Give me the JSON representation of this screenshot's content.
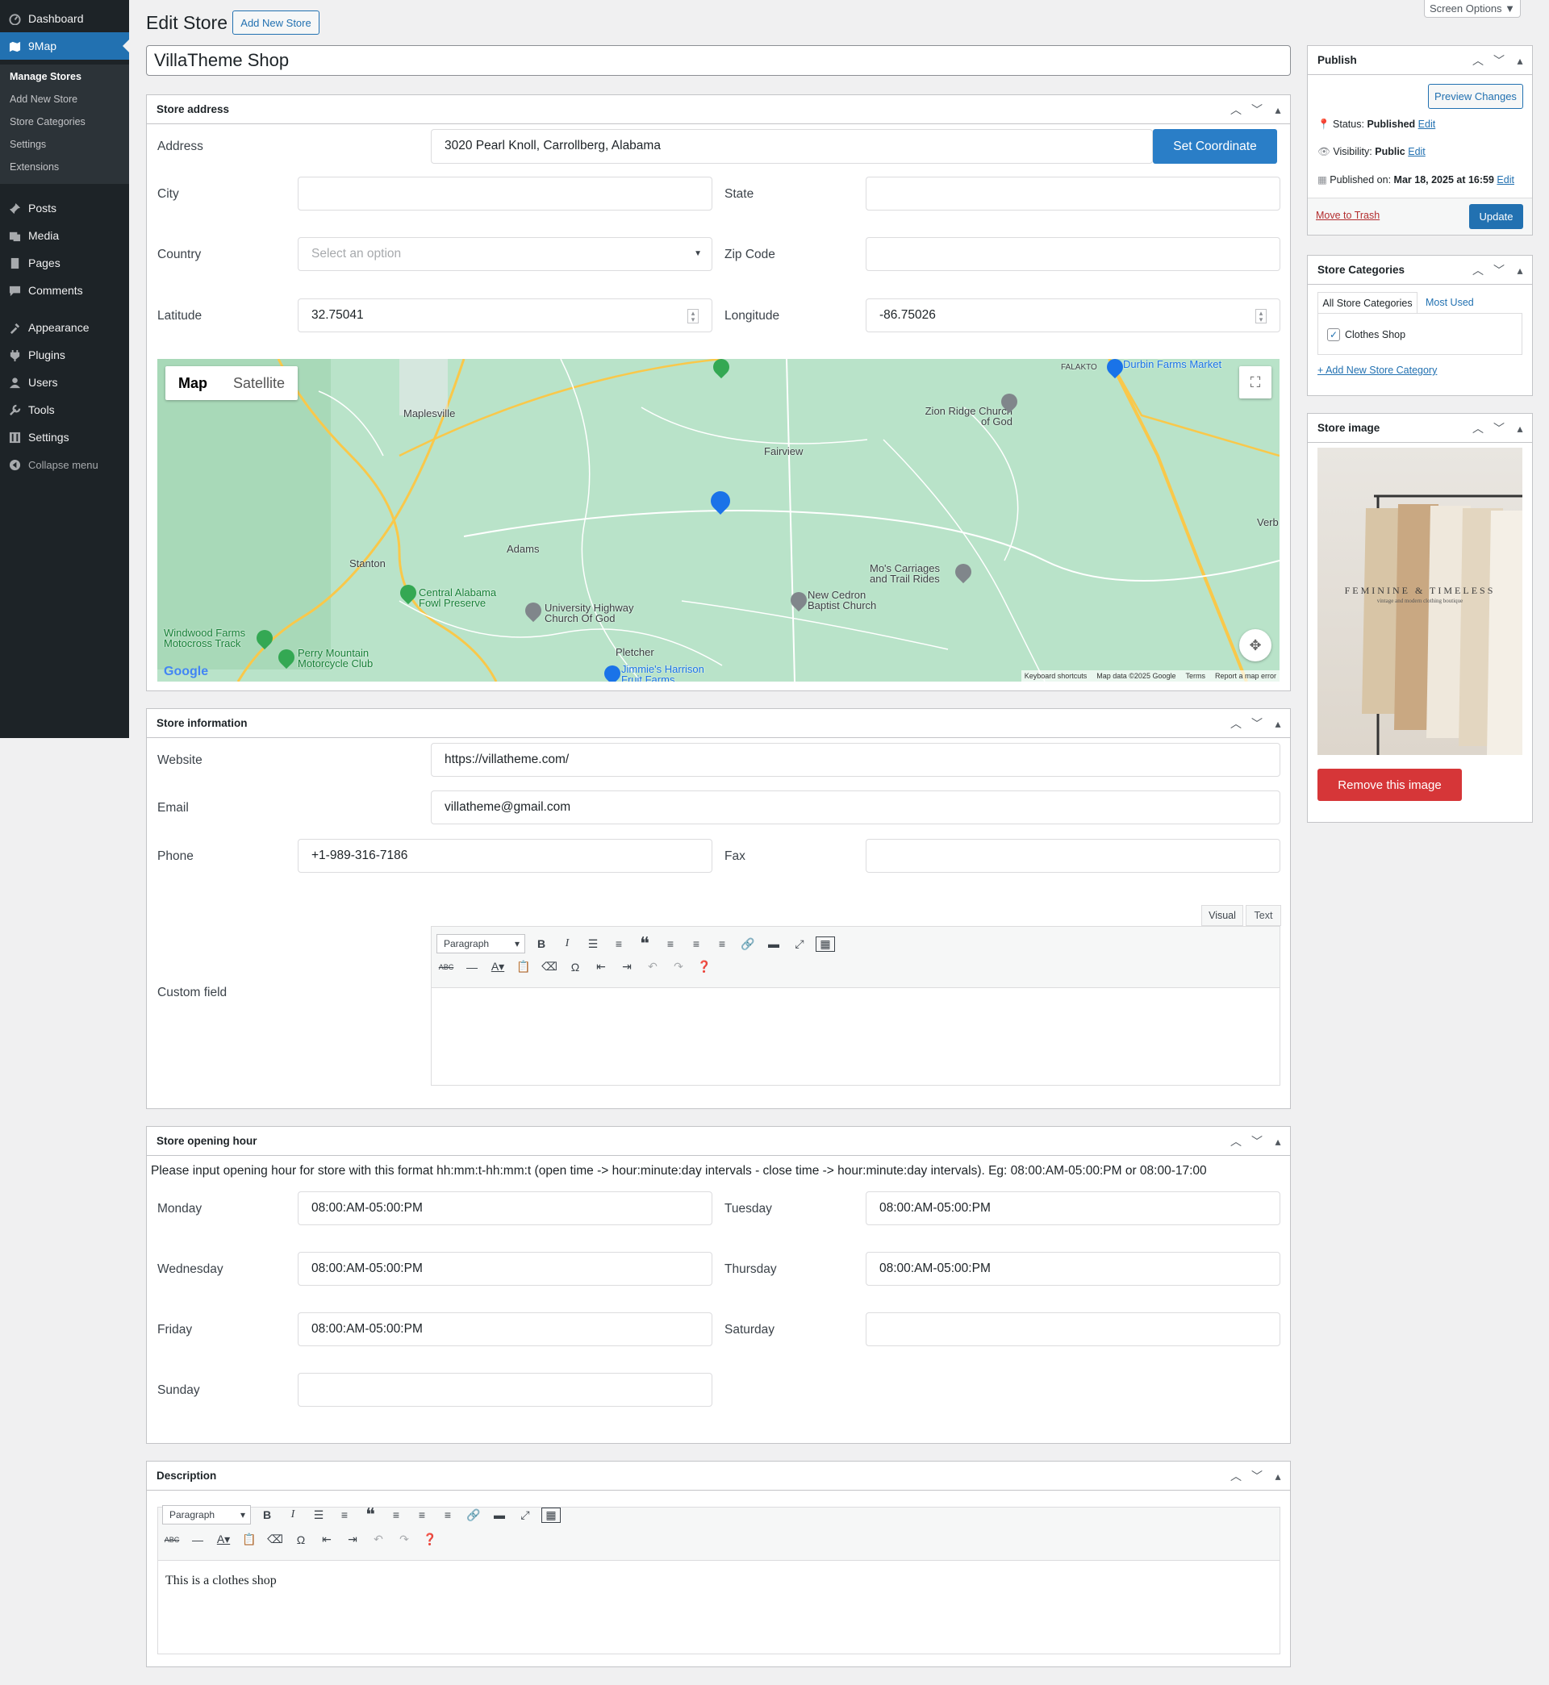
{
  "sidebar": {
    "items": [
      {
        "label": "Dashboard",
        "icon": "dashboard-icon"
      },
      {
        "label": "9Map",
        "icon": "map-icon"
      },
      {
        "label": "Posts",
        "icon": "pin-icon"
      },
      {
        "label": "Media",
        "icon": "media-icon"
      },
      {
        "label": "Pages",
        "icon": "pages-icon"
      },
      {
        "label": "Comments",
        "icon": "comments-icon"
      },
      {
        "label": "Appearance",
        "icon": "appearance-icon"
      },
      {
        "label": "Plugins",
        "icon": "plugins-icon"
      },
      {
        "label": "Users",
        "icon": "users-icon"
      },
      {
        "label": "Tools",
        "icon": "tools-icon"
      },
      {
        "label": "Settings",
        "icon": "settings-icon"
      },
      {
        "label": "Collapse menu",
        "icon": "collapse-icon"
      }
    ],
    "submenu": [
      "Manage Stores",
      "Add New Store",
      "Store Categories",
      "Settings",
      "Extensions"
    ]
  },
  "header": {
    "title": "Edit Store",
    "add_new": "Add New Store",
    "screen_options": "Screen Options ▼"
  },
  "post_title": "VillaTheme Shop",
  "store_address": {
    "heading": "Store address",
    "address_label": "Address",
    "address_value": "3020 Pearl Knoll, Carrollberg, Alabama",
    "set_coordinate": "Set Coordinate",
    "city_label": "City",
    "city_value": "",
    "state_label": "State",
    "state_value": "",
    "country_label": "Country",
    "country_placeholder": "Select an option",
    "zip_label": "Zip Code",
    "zip_value": "",
    "latitude_label": "Latitude",
    "latitude_value": "32.75041",
    "longitude_label": "Longitude",
    "longitude_value": "-86.75026"
  },
  "map": {
    "map_btn": "Map",
    "satellite_btn": "Satellite",
    "labels": [
      "Maplesville",
      "Fairview",
      "Adams",
      "Stanton",
      "Pletcher",
      "Verb"
    ],
    "pois_green": [
      "Central Alabama Fowl Preserve",
      "Windwood Farms Motocross Track",
      "Perry Mountain Motorcycle Club"
    ],
    "pois_gray": [
      "Zion Ridge Church of God",
      "Mo's Carriages and Trail Rides",
      "New Cedron Baptist Church",
      "University Highway Church Of God"
    ],
    "pois_blue": [
      "Durbin Farms Market",
      "Jimmie's Harrison Fruit Farms"
    ],
    "falakto": "FALAKTO",
    "logo": "Google",
    "footer": [
      "Keyboard shortcuts",
      "Map data ©2025 Google",
      "Terms",
      "Report a map error"
    ]
  },
  "store_info": {
    "heading": "Store information",
    "website_label": "Website",
    "website_value": "https://villatheme.com/",
    "email_label": "Email",
    "email_value": "villatheme@gmail.com",
    "phone_label": "Phone",
    "phone_value": "+1-989-316-7186",
    "fax_label": "Fax",
    "fax_value": "",
    "custom_label": "Custom field",
    "tab_visual": "Visual",
    "tab_text": "Text",
    "paragraph": "Paragraph"
  },
  "opening": {
    "heading": "Store opening hour",
    "note": "Please input opening hour for store with this format hh:mm:t-hh:mm:t (open time -> hour:minute:day intervals - close time -> hour:minute:day intervals). Eg: 08:00:AM-05:00:PM or 08:00-17:00",
    "days": [
      {
        "label": "Monday",
        "value": "08:00:AM-05:00:PM"
      },
      {
        "label": "Tuesday",
        "value": "08:00:AM-05:00:PM"
      },
      {
        "label": "Wednesday",
        "value": "08:00:AM-05:00:PM"
      },
      {
        "label": "Thursday",
        "value": "08:00:AM-05:00:PM"
      },
      {
        "label": "Friday",
        "value": "08:00:AM-05:00:PM"
      },
      {
        "label": "Saturday",
        "value": ""
      },
      {
        "label": "Sunday",
        "value": ""
      }
    ]
  },
  "description": {
    "heading": "Description",
    "paragraph": "Paragraph",
    "content": "This is a clothes shop"
  },
  "publish": {
    "heading": "Publish",
    "preview": "Preview Changes",
    "status_prefix": "Status:",
    "status": "Published",
    "visibility_prefix": "Visibility:",
    "visibility": "Public",
    "published_prefix": "Published on:",
    "published_date": "Mar 18, 2025 at 16:59",
    "edit": "Edit",
    "trash": "Move to Trash",
    "update": "Update"
  },
  "categories": {
    "heading": "Store Categories",
    "tab_all": "All Store Categories",
    "tab_used": "Most Used",
    "item": "Clothes Shop",
    "item_checked": true,
    "add_new": "+ Add New Store Category"
  },
  "store_image": {
    "heading": "Store image",
    "image_text": "FEMININE & TIMELESS",
    "image_subtext": "vintage and modern clothing boutique",
    "remove": "Remove this image"
  },
  "colors": {
    "accent": "#2271b1",
    "danger": "#d63638",
    "admin_bar": "#1d2327"
  }
}
